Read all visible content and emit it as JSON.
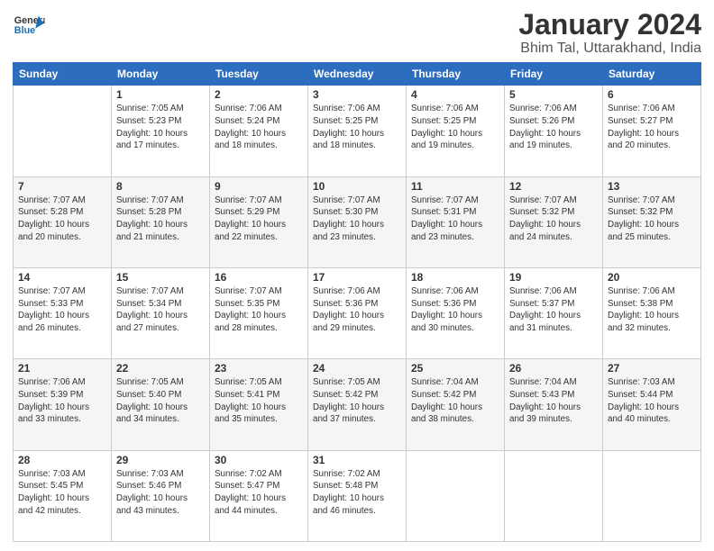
{
  "logo": {
    "line1": "General",
    "line2": "Blue"
  },
  "title": "January 2024",
  "subtitle": "Bhim Tal, Uttarakhand, India",
  "weekdays": [
    "Sunday",
    "Monday",
    "Tuesday",
    "Wednesday",
    "Thursday",
    "Friday",
    "Saturday"
  ],
  "weeks": [
    [
      {
        "day": "",
        "info": ""
      },
      {
        "day": "1",
        "info": "Sunrise: 7:05 AM\nSunset: 5:23 PM\nDaylight: 10 hours\nand 17 minutes."
      },
      {
        "day": "2",
        "info": "Sunrise: 7:06 AM\nSunset: 5:24 PM\nDaylight: 10 hours\nand 18 minutes."
      },
      {
        "day": "3",
        "info": "Sunrise: 7:06 AM\nSunset: 5:25 PM\nDaylight: 10 hours\nand 18 minutes."
      },
      {
        "day": "4",
        "info": "Sunrise: 7:06 AM\nSunset: 5:25 PM\nDaylight: 10 hours\nand 19 minutes."
      },
      {
        "day": "5",
        "info": "Sunrise: 7:06 AM\nSunset: 5:26 PM\nDaylight: 10 hours\nand 19 minutes."
      },
      {
        "day": "6",
        "info": "Sunrise: 7:06 AM\nSunset: 5:27 PM\nDaylight: 10 hours\nand 20 minutes."
      }
    ],
    [
      {
        "day": "7",
        "info": "Sunrise: 7:07 AM\nSunset: 5:28 PM\nDaylight: 10 hours\nand 20 minutes."
      },
      {
        "day": "8",
        "info": "Sunrise: 7:07 AM\nSunset: 5:28 PM\nDaylight: 10 hours\nand 21 minutes."
      },
      {
        "day": "9",
        "info": "Sunrise: 7:07 AM\nSunset: 5:29 PM\nDaylight: 10 hours\nand 22 minutes."
      },
      {
        "day": "10",
        "info": "Sunrise: 7:07 AM\nSunset: 5:30 PM\nDaylight: 10 hours\nand 23 minutes."
      },
      {
        "day": "11",
        "info": "Sunrise: 7:07 AM\nSunset: 5:31 PM\nDaylight: 10 hours\nand 23 minutes."
      },
      {
        "day": "12",
        "info": "Sunrise: 7:07 AM\nSunset: 5:32 PM\nDaylight: 10 hours\nand 24 minutes."
      },
      {
        "day": "13",
        "info": "Sunrise: 7:07 AM\nSunset: 5:32 PM\nDaylight: 10 hours\nand 25 minutes."
      }
    ],
    [
      {
        "day": "14",
        "info": "Sunrise: 7:07 AM\nSunset: 5:33 PM\nDaylight: 10 hours\nand 26 minutes."
      },
      {
        "day": "15",
        "info": "Sunrise: 7:07 AM\nSunset: 5:34 PM\nDaylight: 10 hours\nand 27 minutes."
      },
      {
        "day": "16",
        "info": "Sunrise: 7:07 AM\nSunset: 5:35 PM\nDaylight: 10 hours\nand 28 minutes."
      },
      {
        "day": "17",
        "info": "Sunrise: 7:06 AM\nSunset: 5:36 PM\nDaylight: 10 hours\nand 29 minutes."
      },
      {
        "day": "18",
        "info": "Sunrise: 7:06 AM\nSunset: 5:36 PM\nDaylight: 10 hours\nand 30 minutes."
      },
      {
        "day": "19",
        "info": "Sunrise: 7:06 AM\nSunset: 5:37 PM\nDaylight: 10 hours\nand 31 minutes."
      },
      {
        "day": "20",
        "info": "Sunrise: 7:06 AM\nSunset: 5:38 PM\nDaylight: 10 hours\nand 32 minutes."
      }
    ],
    [
      {
        "day": "21",
        "info": "Sunrise: 7:06 AM\nSunset: 5:39 PM\nDaylight: 10 hours\nand 33 minutes."
      },
      {
        "day": "22",
        "info": "Sunrise: 7:05 AM\nSunset: 5:40 PM\nDaylight: 10 hours\nand 34 minutes."
      },
      {
        "day": "23",
        "info": "Sunrise: 7:05 AM\nSunset: 5:41 PM\nDaylight: 10 hours\nand 35 minutes."
      },
      {
        "day": "24",
        "info": "Sunrise: 7:05 AM\nSunset: 5:42 PM\nDaylight: 10 hours\nand 37 minutes."
      },
      {
        "day": "25",
        "info": "Sunrise: 7:04 AM\nSunset: 5:42 PM\nDaylight: 10 hours\nand 38 minutes."
      },
      {
        "day": "26",
        "info": "Sunrise: 7:04 AM\nSunset: 5:43 PM\nDaylight: 10 hours\nand 39 minutes."
      },
      {
        "day": "27",
        "info": "Sunrise: 7:03 AM\nSunset: 5:44 PM\nDaylight: 10 hours\nand 40 minutes."
      }
    ],
    [
      {
        "day": "28",
        "info": "Sunrise: 7:03 AM\nSunset: 5:45 PM\nDaylight: 10 hours\nand 42 minutes."
      },
      {
        "day": "29",
        "info": "Sunrise: 7:03 AM\nSunset: 5:46 PM\nDaylight: 10 hours\nand 43 minutes."
      },
      {
        "day": "30",
        "info": "Sunrise: 7:02 AM\nSunset: 5:47 PM\nDaylight: 10 hours\nand 44 minutes."
      },
      {
        "day": "31",
        "info": "Sunrise: 7:02 AM\nSunset: 5:48 PM\nDaylight: 10 hours\nand 46 minutes."
      },
      {
        "day": "",
        "info": ""
      },
      {
        "day": "",
        "info": ""
      },
      {
        "day": "",
        "info": ""
      }
    ]
  ]
}
